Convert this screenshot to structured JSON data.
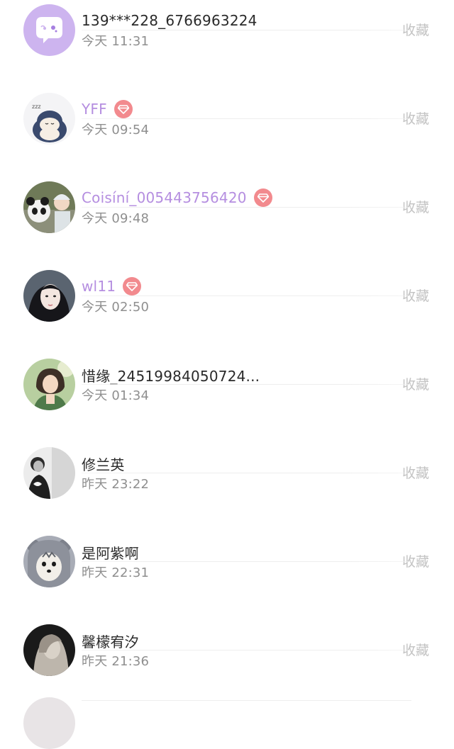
{
  "rows": [
    {
      "name": "139***228_6766963224",
      "time": "今天 11:31",
      "action": "收藏",
      "vip": false
    },
    {
      "name": "YFF",
      "time": "今天 09:54",
      "action": "收藏",
      "vip": true
    },
    {
      "name": "Coisíní_005443756420",
      "time": "今天 09:48",
      "action": "收藏",
      "vip": true
    },
    {
      "name": "wl11",
      "time": "今天 02:50",
      "action": "收藏",
      "vip": true
    },
    {
      "name": "惜缘_24519984050724...",
      "time": "今天 01:34",
      "action": "收藏",
      "vip": false
    },
    {
      "name": "修兰英",
      "time": "昨天 23:22",
      "action": "收藏",
      "vip": false
    },
    {
      "name": "是阿紫啊",
      "time": "昨天 22:31",
      "action": "收藏",
      "vip": false
    },
    {
      "name": "馨檬宥汐",
      "time": "昨天 21:36",
      "action": "收藏",
      "vip": false
    }
  ],
  "colors": {
    "vip_name": "#b58ee0",
    "vip_badge": "#f28a8e",
    "default_avatar": "#cdb4ef",
    "action_text": "#c3c3c3",
    "time_text": "#8f8f8f"
  }
}
